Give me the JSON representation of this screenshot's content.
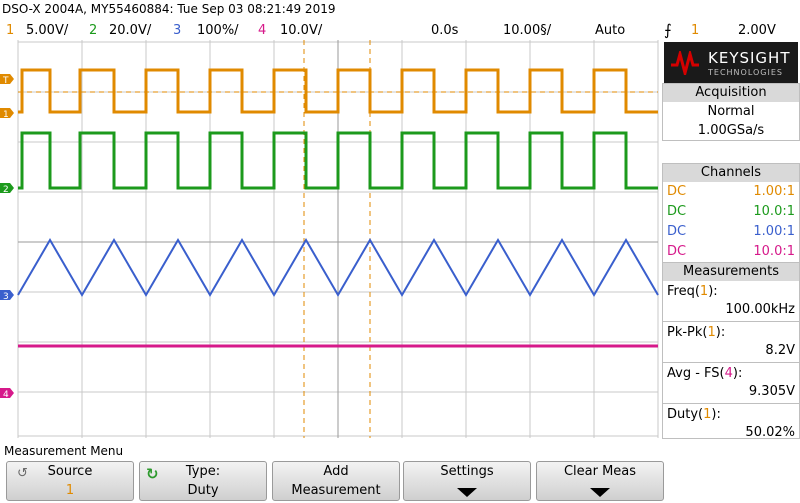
{
  "title": "DSO-X 2004A, MY55460884: Tue Sep 03 08:21:49 2019",
  "channels_header": [
    {
      "num": "1",
      "scale": "5.00V/",
      "color": "#e08a00"
    },
    {
      "num": "2",
      "scale": "20.0V/",
      "color": "#1c9a1c"
    },
    {
      "num": "3",
      "scale": "100%/",
      "color": "#3a5fcd"
    },
    {
      "num": "4",
      "scale": "10.0V/",
      "color": "#d6198a"
    }
  ],
  "timebase": {
    "delay": "0.0s",
    "scale": "10.00§/",
    "mode": "Auto"
  },
  "trigger": {
    "icon": "trigger-edge-icon",
    "channel": "1",
    "level": "2.00V"
  },
  "brand": {
    "name": "KEYSIGHT",
    "sub": "TECHNOLOGIES",
    "color": "#d40000"
  },
  "acquisition": {
    "title": "Acquisition",
    "mode": "Normal",
    "rate": "1.00GSa/s"
  },
  "channels_panel": {
    "title": "Channels",
    "rows": [
      {
        "coupling": "DC",
        "probe": "1.00:1",
        "color": "#e08a00"
      },
      {
        "coupling": "DC",
        "probe": "10.0:1",
        "color": "#1c9a1c"
      },
      {
        "coupling": "DC",
        "probe": "1.00:1",
        "color": "#3a5fcd"
      },
      {
        "coupling": "DC",
        "probe": "10.0:1",
        "color": "#d6198a"
      }
    ]
  },
  "measurements": {
    "title": "Measurements",
    "items": [
      {
        "name": "Freq(",
        "src": "1",
        "close": "):",
        "value": "100.00kHz",
        "src_color": "#e08a00"
      },
      {
        "name": "Pk-Pk(",
        "src": "1",
        "close": "):",
        "value": "8.2V",
        "src_color": "#e08a00"
      },
      {
        "name": "Avg - FS(",
        "src": "4",
        "close": "):",
        "value": "9.305V",
        "src_color": "#d6198a"
      },
      {
        "name": "Duty(",
        "src": "1",
        "close": "):",
        "value": "50.02%",
        "src_color": "#e08a00"
      }
    ]
  },
  "markers": {
    "trig": "T",
    "ch1": "1",
    "ch2": "2",
    "ch3": "3",
    "ch4": "4"
  },
  "menu": {
    "title": "Measurement Menu",
    "softkeys": [
      {
        "line1": "Source",
        "line2": "1"
      },
      {
        "line1": "Type:",
        "line2": "Duty"
      },
      {
        "line1": "Add",
        "line2": "Measurement"
      },
      {
        "line1": "Settings",
        "line2": ""
      },
      {
        "line1": "Clear Meas",
        "line2": ""
      }
    ]
  }
}
